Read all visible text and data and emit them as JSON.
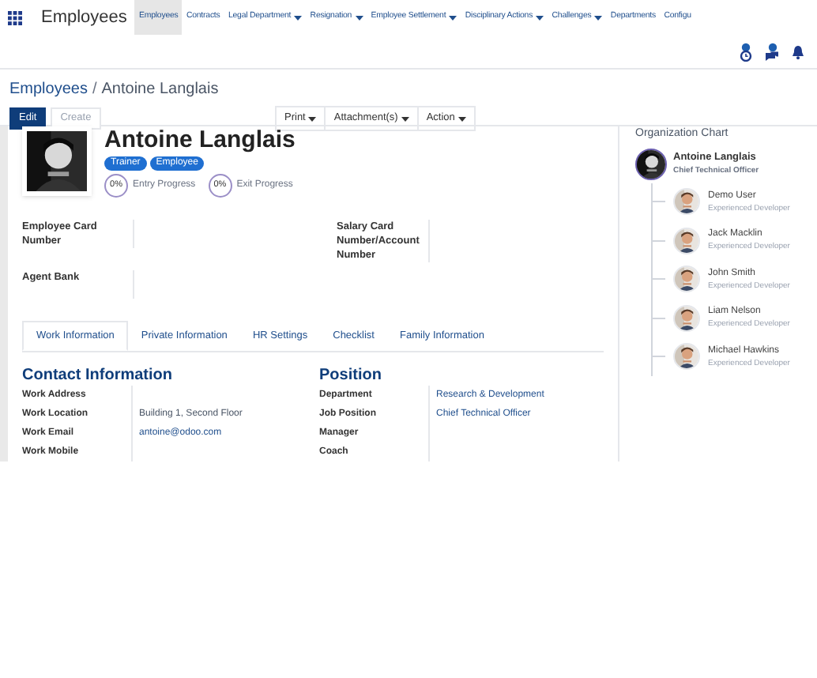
{
  "app_title": "Employees",
  "nav": [
    {
      "label": "Employees",
      "selected": true,
      "dropdown": false
    },
    {
      "label": "Contracts",
      "selected": false,
      "dropdown": false
    },
    {
      "label": "Legal Department",
      "selected": false,
      "dropdown": true
    },
    {
      "label": "Resignation",
      "selected": false,
      "dropdown": true
    },
    {
      "label": "Employee Settlement",
      "selected": false,
      "dropdown": true
    },
    {
      "label": "Disciplinary Actions",
      "selected": false,
      "dropdown": true
    },
    {
      "label": "Challenges",
      "selected": false,
      "dropdown": true
    },
    {
      "label": "Departments",
      "selected": false,
      "dropdown": false
    },
    {
      "label": "Configu",
      "selected": false,
      "dropdown": false
    }
  ],
  "breadcrumb": {
    "parent": "Employees",
    "separator": "/",
    "current": "Antoine Langlais"
  },
  "buttons": [
    {
      "label": "Edit",
      "kind": "primary"
    },
    {
      "label": "Create",
      "kind": "secondary"
    }
  ],
  "actions": [
    {
      "label": "Print"
    },
    {
      "label": "Attachment(s)"
    },
    {
      "label": "Action"
    }
  ],
  "employee": {
    "name": "Antoine Langlais",
    "tags": [
      "Trainer",
      "Employee"
    ],
    "progress": [
      {
        "value": "0%",
        "label": "Entry Progress"
      },
      {
        "value": "0%",
        "label": "Exit Progress"
      }
    ]
  },
  "fields_left": [
    {
      "label": "Employee Card Number"
    },
    {
      "label": "Agent Bank"
    }
  ],
  "fields_right": [
    {
      "label": "Salary Card Number/Account Number"
    }
  ],
  "tabs": [
    {
      "label": "Work Information",
      "selected": true
    },
    {
      "label": "Private Information",
      "selected": false
    },
    {
      "label": "HR Settings",
      "selected": false
    },
    {
      "label": "Checklist",
      "selected": false
    },
    {
      "label": "Family Information",
      "selected": false
    }
  ],
  "contact": {
    "title": "Contact Information",
    "rows": [
      {
        "label": "Work Address"
      },
      {
        "label": "Work Location",
        "value": "Building 1, Second Floor",
        "link": false
      },
      {
        "label": "Work Email",
        "value": "antoine@odoo.com",
        "link": true
      },
      {
        "label": "Work Mobile"
      }
    ]
  },
  "position": {
    "title": "Position",
    "rows": [
      {
        "label": "Department",
        "value": "Research & Development",
        "link": true
      },
      {
        "label": "Job Position",
        "value": "Chief Technical Officer",
        "link": true
      },
      {
        "label": "Manager"
      },
      {
        "label": "Coach"
      }
    ]
  },
  "org_chart": {
    "title": "Organization Chart",
    "self": {
      "name": "Antoine Langlais",
      "role": "Chief Technical Officer"
    },
    "reports": [
      {
        "name": "Demo User",
        "role": "Experienced Developer"
      },
      {
        "name": "Jack Macklin",
        "role": "Experienced Developer"
      },
      {
        "name": "John Smith",
        "role": "Experienced Developer"
      },
      {
        "name": "Liam Nelson",
        "role": "Experienced Developer"
      },
      {
        "name": "Michael Hawkins",
        "role": "Experienced Developer"
      }
    ]
  }
}
